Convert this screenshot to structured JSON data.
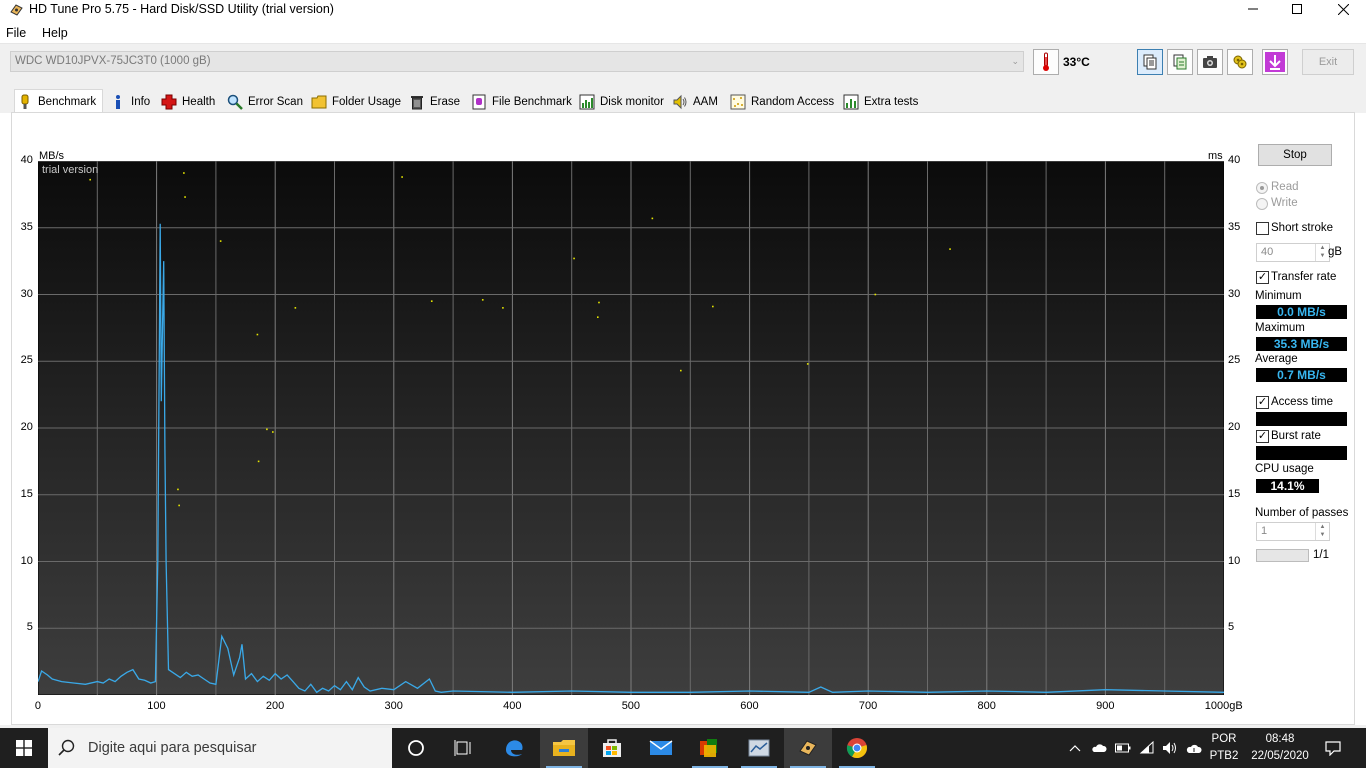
{
  "window": {
    "title": "HD Tune Pro 5.75 - Hard Disk/SSD Utility (trial version)"
  },
  "menu": {
    "items": [
      "File",
      "Help"
    ]
  },
  "toolbar": {
    "drive": "WDC WD10JPVX-75JC3T0 (1000 gB)",
    "temperature": "33°C",
    "exit_label": "Exit"
  },
  "tabs": [
    "Benchmark",
    "Info",
    "Health",
    "Error Scan",
    "Folder Usage",
    "Erase",
    "File Benchmark",
    "Disk monitor",
    "AAM",
    "Random Access",
    "Extra tests"
  ],
  "sidebar": {
    "stop_label": "Stop",
    "read_label": "Read",
    "write_label": "Write",
    "short_stroke_label": "Short stroke",
    "short_stroke_value": "40",
    "short_stroke_unit": "gB",
    "transfer_rate_label": "Transfer rate",
    "minimum_label": "Minimum",
    "minimum_value": "0.0 MB/s",
    "maximum_label": "Maximum",
    "maximum_value": "35.3 MB/s",
    "average_label": "Average",
    "average_value": "0.7 MB/s",
    "access_time_label": "Access time",
    "burst_rate_label": "Burst rate",
    "cpu_usage_label": "CPU usage",
    "cpu_usage_value": "14.1%",
    "passes_label": "Number of passes",
    "passes_value": "1",
    "passes_progress": "1/1"
  },
  "chart_data": {
    "type": "line",
    "watermark": "trial version",
    "ylabel_left": "MB/s",
    "ylabel_right": "ms",
    "ylim": [
      0,
      40
    ],
    "xlim": [
      0,
      1000
    ],
    "y_ticks": [
      5,
      10,
      15,
      20,
      25,
      30,
      35,
      40
    ],
    "x_ticks": [
      "0",
      "100",
      "200",
      "300",
      "400",
      "500",
      "600",
      "700",
      "800",
      "900",
      "1000gB"
    ],
    "grid": true,
    "series": [
      {
        "x": [
          0,
          3,
          8,
          12,
          20,
          30,
          40,
          50,
          55,
          60,
          65,
          70,
          75,
          80,
          85,
          90,
          95,
          99,
          101,
          103,
          104,
          105,
          106,
          107,
          108,
          110,
          115,
          120,
          125,
          130,
          135,
          140,
          145,
          150,
          155,
          160,
          165,
          170,
          172,
          175,
          180,
          185,
          190,
          195,
          200,
          205,
          210,
          215,
          220,
          225,
          230,
          235,
          240,
          245,
          250,
          255,
          260,
          265,
          270,
          275,
          280,
          290,
          300,
          310,
          320,
          330,
          335,
          340,
          350,
          400,
          450,
          500,
          550,
          600,
          650,
          660,
          670,
          700,
          750,
          800,
          850,
          900,
          950,
          1000
        ],
        "y": [
          1.0,
          1.8,
          1.5,
          1.2,
          1.0,
          0.9,
          0.8,
          1.0,
          0.9,
          1.2,
          1.0,
          1.4,
          1.7,
          1.9,
          1.2,
          1.1,
          0.9,
          1.0,
          10.0,
          35.3,
          22.0,
          27.5,
          32.5,
          18.5,
          10.0,
          1.9,
          1.6,
          1.3,
          1.7,
          1.4,
          1.5,
          1.2,
          0.9,
          0.8,
          4.4,
          3.5,
          1.5,
          2.8,
          3.8,
          1.2,
          1.6,
          1.0,
          1.4,
          1.1,
          1.6,
          1.2,
          1.5,
          1.0,
          0.5,
          0.3,
          0.8,
          0.2,
          0.5,
          0.3,
          0.7,
          0.4,
          1.0,
          0.4,
          1.3,
          0.6,
          0.3,
          0.5,
          0.4,
          1.0,
          0.5,
          1.2,
          0.3,
          0.2,
          0.3,
          0.2,
          0.3,
          0.2,
          0.2,
          0.3,
          0.2,
          0.6,
          0.2,
          0.3,
          0.2,
          0.3,
          0.2,
          0.4,
          0.3,
          0.2
        ]
      },
      {
        "type": "scatter",
        "x": [
          44,
          123,
          124,
          154,
          118,
          119,
          185,
          186,
          193,
          198,
          217,
          307,
          332,
          375,
          392,
          452,
          472,
          473,
          518,
          542,
          569,
          649,
          706,
          769
        ],
        "y": [
          38.6,
          39.1,
          37.3,
          34.0,
          15.4,
          14.2,
          27.0,
          17.5,
          19.9,
          19.7,
          29.0,
          38.8,
          29.5,
          29.6,
          29.0,
          32.7,
          28.3,
          29.4,
          35.7,
          24.3,
          29.1,
          24.8,
          30.0,
          33.4
        ]
      }
    ]
  },
  "taskbar": {
    "search_placeholder": "Digite aqui para pesquisar",
    "language_top": "POR",
    "language_bottom": "PTB2",
    "time": "08:48",
    "date": "22/05/2020"
  },
  "colors": {
    "accent": "#3aa9e8",
    "chart_bg": "#0b0b0b",
    "taskbar": "#1f1f1f"
  }
}
